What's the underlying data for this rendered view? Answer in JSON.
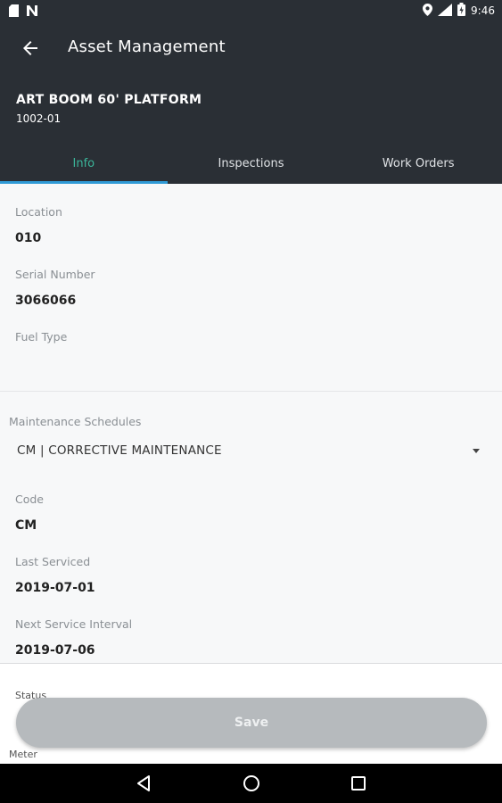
{
  "status_bar": {
    "time": "9:46",
    "icons": [
      "sd-card-icon",
      "n-notification-icon",
      "location-icon",
      "signal-icon",
      "battery-icon"
    ]
  },
  "app_bar": {
    "title": "Asset Management",
    "back_icon": "arrow-left-icon"
  },
  "asset": {
    "name": "ART BOOM 60' PLATFORM",
    "id": "1002-01"
  },
  "tabs": [
    {
      "label": "Info",
      "active": true
    },
    {
      "label": "Inspections",
      "active": false
    },
    {
      "label": "Work Orders",
      "active": false
    }
  ],
  "info": {
    "location_label": "Location",
    "location_value": "010",
    "serial_label": "Serial Number",
    "serial_value": "3066066",
    "fuel_label": "Fuel Type",
    "fuel_value": ""
  },
  "maintenance": {
    "label": "Maintenance Schedules",
    "selected": "CM | CORRECTIVE MAINTENANCE",
    "code_label": "Code",
    "code_value": "CM",
    "last_serviced_label": "Last Serviced",
    "last_serviced_value": "2019-07-01",
    "next_interval_label": "Next Service Interval",
    "next_interval_value": "2019-07-06"
  },
  "bottom": {
    "status_label": "Status",
    "meter_label": "Meter",
    "save_label": "Save"
  },
  "colors": {
    "header_bg": "#2a2f35",
    "active_tab_text": "#3bb59a",
    "active_tab_indicator": "#2f9ad6",
    "save_disabled_bg": "#b6babd"
  }
}
